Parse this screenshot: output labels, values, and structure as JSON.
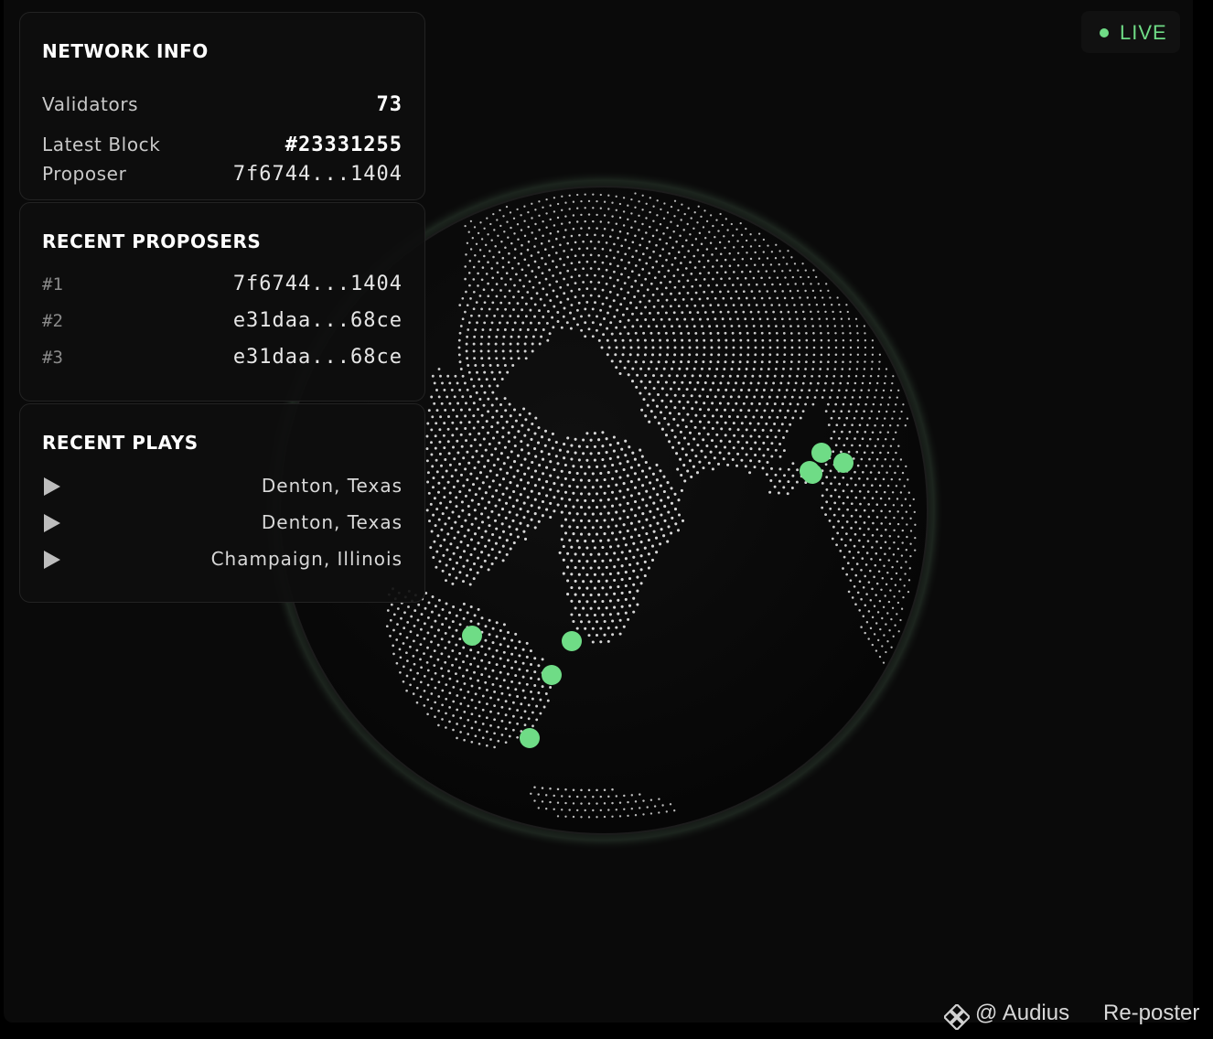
{
  "network_info": {
    "title": "NETWORK INFO",
    "validators_label": "Validators",
    "validators_value": "73",
    "latest_block_label": "Latest Block",
    "latest_block_value": "#23331255",
    "proposer_label": "Proposer",
    "proposer_value": "7f6744...1404"
  },
  "recent_proposers": {
    "title": "RECENT PROPOSERS",
    "items": [
      {
        "rank": "#1",
        "address": "7f6744...1404"
      },
      {
        "rank": "#2",
        "address": "e31daa...68ce"
      },
      {
        "rank": "#3",
        "address": "e31daa...68ce"
      }
    ]
  },
  "recent_plays": {
    "title": "RECENT PLAYS",
    "items": [
      {
        "location": "Denton, Texas"
      },
      {
        "location": "Denton, Texas"
      },
      {
        "location": "Champaign, Illinois"
      }
    ]
  },
  "status": {
    "label": "LIVE",
    "color": "#6fdc86"
  },
  "globe": {
    "marker_color": "#6fdc86",
    "dot_color": "#d9d9d9",
    "marker_count": 7
  },
  "attribution": {
    "brand": "@ Audius",
    "reposter": "Re-poster"
  }
}
